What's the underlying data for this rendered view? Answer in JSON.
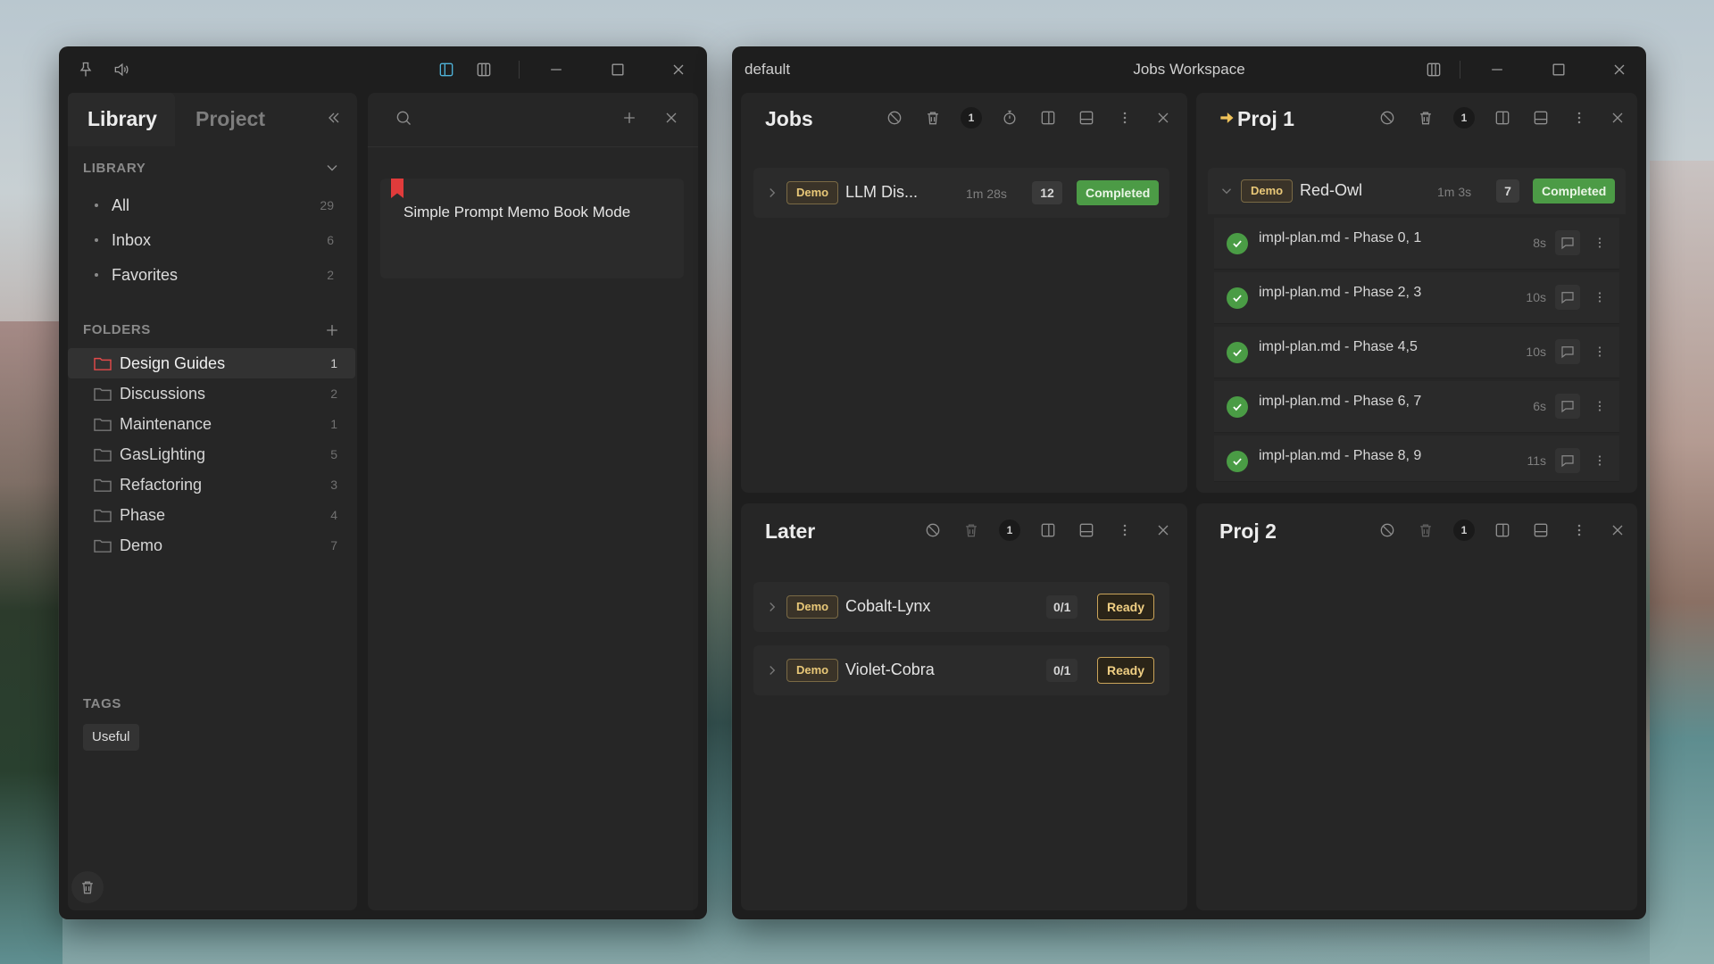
{
  "library_window": {
    "titlebar_icons": [
      "pin-icon",
      "speaker-icon",
      "sidebar-left-icon",
      "columns-icon"
    ],
    "tabs": {
      "library": "Library",
      "project": "Project"
    },
    "library_section": {
      "title": "LIBRARY",
      "items": [
        {
          "label": "All",
          "count": "29"
        },
        {
          "label": "Inbox",
          "count": "6"
        },
        {
          "label": "Favorites",
          "count": "2"
        }
      ]
    },
    "folders_section": {
      "title": "FOLDERS",
      "items": [
        {
          "label": "Design Guides",
          "count": "1"
        },
        {
          "label": "Discussions",
          "count": "2"
        },
        {
          "label": "Maintenance",
          "count": "1"
        },
        {
          "label": "GasLighting",
          "count": "5"
        },
        {
          "label": "Refactoring",
          "count": "3"
        },
        {
          "label": "Phase",
          "count": "4"
        },
        {
          "label": "Demo",
          "count": "7"
        }
      ]
    },
    "tags_section": {
      "title": "TAGS",
      "tags": [
        "Useful"
      ]
    },
    "memo": {
      "title": "Simple Prompt Memo Book Mode"
    },
    "colors": {
      "active_folder": "#e24a4a",
      "bookmark": "#e03b3b"
    }
  },
  "jobs_window": {
    "profile": "default",
    "title": "Jobs Workspace",
    "panes": {
      "jobs": {
        "title": "Jobs",
        "badge": "1",
        "rows": [
          {
            "tag": "Demo",
            "name": "LLM Dis...",
            "time": "1m 28s",
            "count": "12",
            "status": "Completed"
          }
        ]
      },
      "proj1": {
        "title": "Proj 1",
        "badge": "1",
        "row": {
          "tag": "Demo",
          "name": "Red-Owl",
          "time": "1m 3s",
          "count": "7",
          "status": "Completed"
        },
        "subtasks": [
          {
            "label": "impl-plan.md - Phase 0, 1",
            "duration": "8s"
          },
          {
            "label": "impl-plan.md - Phase 2, 3",
            "duration": "10s"
          },
          {
            "label": "impl-plan.md - Phase 4,5",
            "duration": "10s"
          },
          {
            "label": "impl-plan.md - Phase 6, 7",
            "duration": "6s"
          },
          {
            "label": "impl-plan.md - Phase 8, 9",
            "duration": "11s"
          }
        ]
      },
      "later": {
        "title": "Later",
        "badge": "1",
        "rows": [
          {
            "tag": "Demo",
            "name": "Cobalt-Lynx",
            "count": "0/1",
            "status": "Ready"
          },
          {
            "tag": "Demo",
            "name": "Violet-Cobra",
            "count": "0/1",
            "status": "Ready"
          }
        ]
      },
      "proj2": {
        "title": "Proj 2",
        "badge": "1"
      }
    },
    "colors": {
      "completed": "#4c9b46",
      "ready": "#caa45a",
      "demo_tag": "#e9c878",
      "proj_arrow": "#f0c35a"
    }
  }
}
